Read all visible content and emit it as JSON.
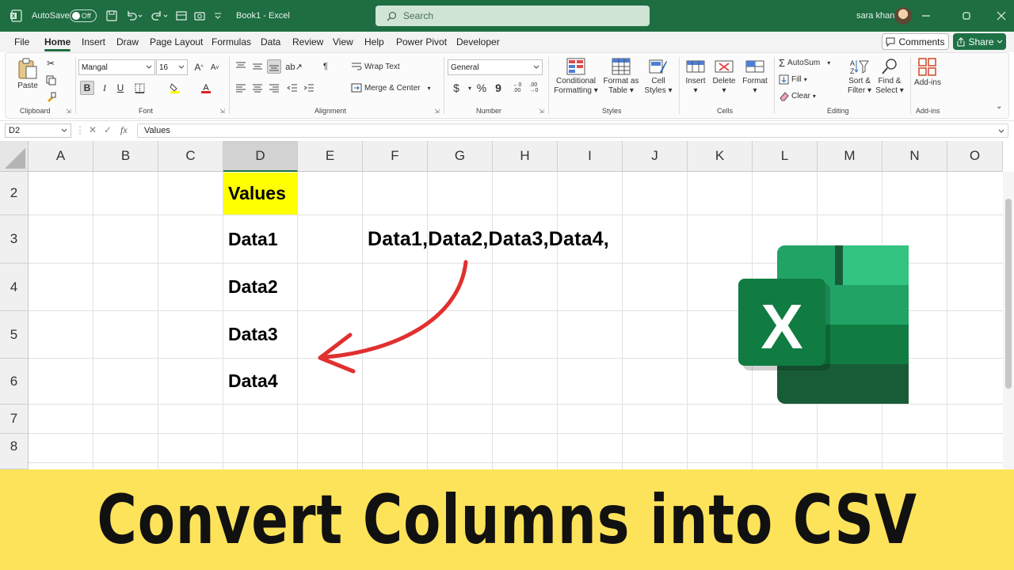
{
  "titlebar": {
    "autosave_label": "AutoSave",
    "toggle_state": "Off",
    "document_title": "Book1 - Excel",
    "search_placeholder": "Search",
    "user_name": "sara khan"
  },
  "tabs": [
    "File",
    "Home",
    "Insert",
    "Draw",
    "Page Layout",
    "Formulas",
    "Data",
    "Review",
    "View",
    "Help",
    "Power Pivot",
    "Developer"
  ],
  "active_tab": "Home",
  "actions": {
    "comments": "Comments",
    "share": "Share"
  },
  "ribbon": {
    "clipboard": {
      "label": "Clipboard",
      "paste": "Paste"
    },
    "font": {
      "label": "Font",
      "font_name": "Mangal",
      "font_size": "16",
      "bold": "B",
      "italic": "I",
      "underline": "U"
    },
    "alignment": {
      "label": "Alignment",
      "wrap_text": "Wrap Text",
      "merge_center": "Merge & Center"
    },
    "number": {
      "label": "Number",
      "format": "General",
      "currency": "$",
      "percent": "%",
      "comma": "9"
    },
    "styles": {
      "label": "Styles",
      "conditional": [
        "Conditional",
        "Formatting"
      ],
      "format_table": [
        "Format as",
        "Table"
      ],
      "cell_styles": [
        "Cell",
        "Styles"
      ]
    },
    "cells": {
      "label": "Cells",
      "insert": "Insert",
      "delete": "Delete",
      "format": "Format"
    },
    "editing": {
      "label": "Editing",
      "autosum": "AutoSum",
      "fill": "Fill",
      "clear": "Clear",
      "sort_filter": [
        "Sort &",
        "Filter"
      ],
      "find_select": [
        "Find &",
        "Select"
      ]
    },
    "addins": {
      "label": "Add-ins",
      "addins_btn": "Add-ins"
    }
  },
  "formula_bar": {
    "name_box": "D2",
    "fx": "fx",
    "value": "Values"
  },
  "sheet": {
    "columns": [
      "A",
      "B",
      "C",
      "D",
      "E",
      "F",
      "G",
      "H",
      "I",
      "J",
      "K",
      "L",
      "M",
      "N",
      "O"
    ],
    "selected_column": "D",
    "rows": [
      "2",
      "3",
      "4",
      "5",
      "6",
      "7",
      "8"
    ],
    "cells": {
      "D2": "Values",
      "D3": "Data1",
      "D4": "Data2",
      "D5": "Data3",
      "D6": "Data4",
      "F3": "Data1,Data2,Data3,Data4,"
    },
    "header_fill": "#ffff00"
  },
  "logo": {
    "letter": "X"
  },
  "banner": {
    "text": "Convert Columns into CSV",
    "background": "#fde35a"
  },
  "colors": {
    "excel_green": "#1e6e42",
    "arrow_red": "#e0302f"
  }
}
